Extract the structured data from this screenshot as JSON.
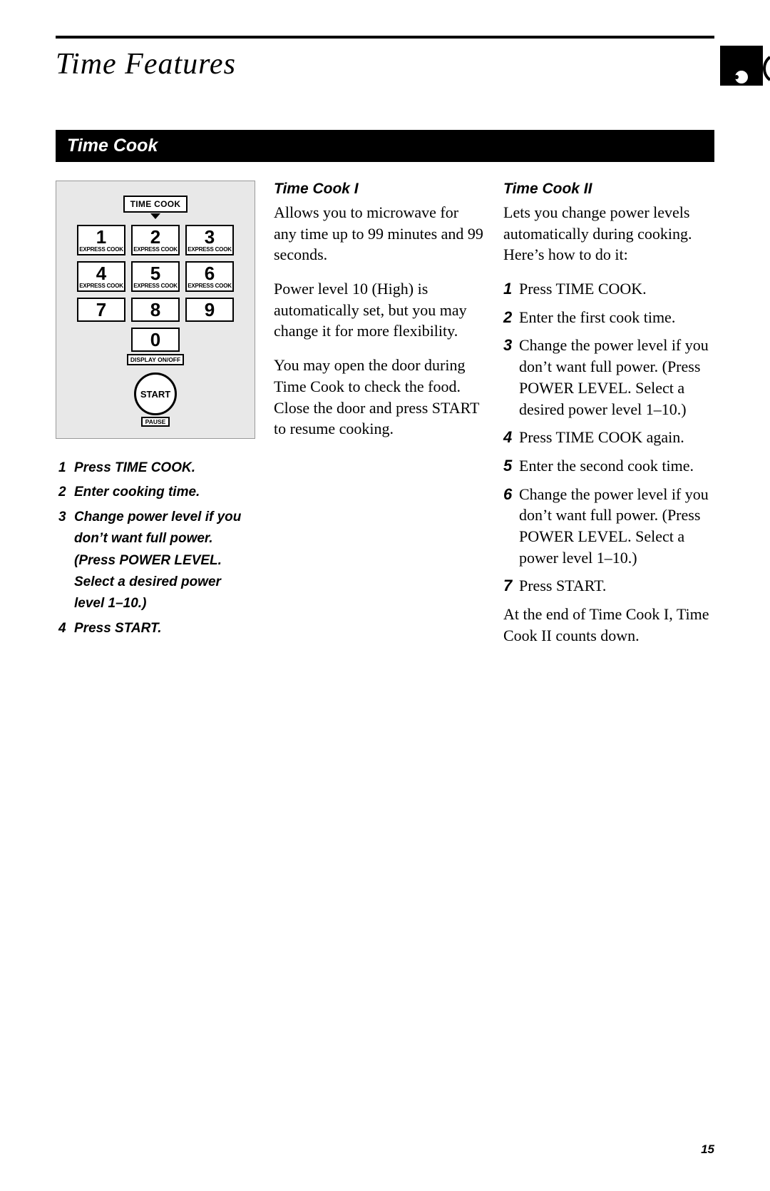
{
  "header": {
    "title": "Time Features"
  },
  "section": {
    "title": "Time Cook"
  },
  "keypad": {
    "timecook_label": "TIME COOK",
    "express_label": "EXPRESS COOK",
    "display_label": "DISPLAY ON/OFF",
    "start_label": "START",
    "pause_label": "PAUSE",
    "keys": [
      "1",
      "2",
      "3",
      "4",
      "5",
      "6",
      "7",
      "8",
      "9",
      "0"
    ]
  },
  "left_steps": [
    "Press TIME COOK.",
    "Enter cooking time.",
    "Change power level if you don’t want full power. (Press POWER LEVEL. Select a desired power level 1–10.)",
    "Press START."
  ],
  "col_mid": {
    "heading": "Time Cook I",
    "p1": "Allows you to microwave for any time up to 99 minutes and 99 seconds.",
    "p2": "Power level 10 (High) is automatically set, but you may change it for more flexibility.",
    "p3": "You may open the door during Time Cook to check the food. Close the door and press START to resume cooking."
  },
  "col_right": {
    "heading": "Time Cook II",
    "intro": "Lets you change power levels automatically during cooking. Here’s how to do it:",
    "steps": [
      "Press TIME COOK.",
      "Enter the first cook time.",
      "Change the power level if you don’t want full power. (Press POWER LEVEL. Select a desired power level 1–10.)",
      "Press TIME COOK again.",
      "Enter the second cook time.",
      "Change the power level if you don’t want full power. (Press POWER LEVEL. Select a power level 1–10.)",
      "Press START."
    ],
    "endnote": "At the end of Time Cook I, Time Cook II counts down."
  },
  "page_number": "15"
}
